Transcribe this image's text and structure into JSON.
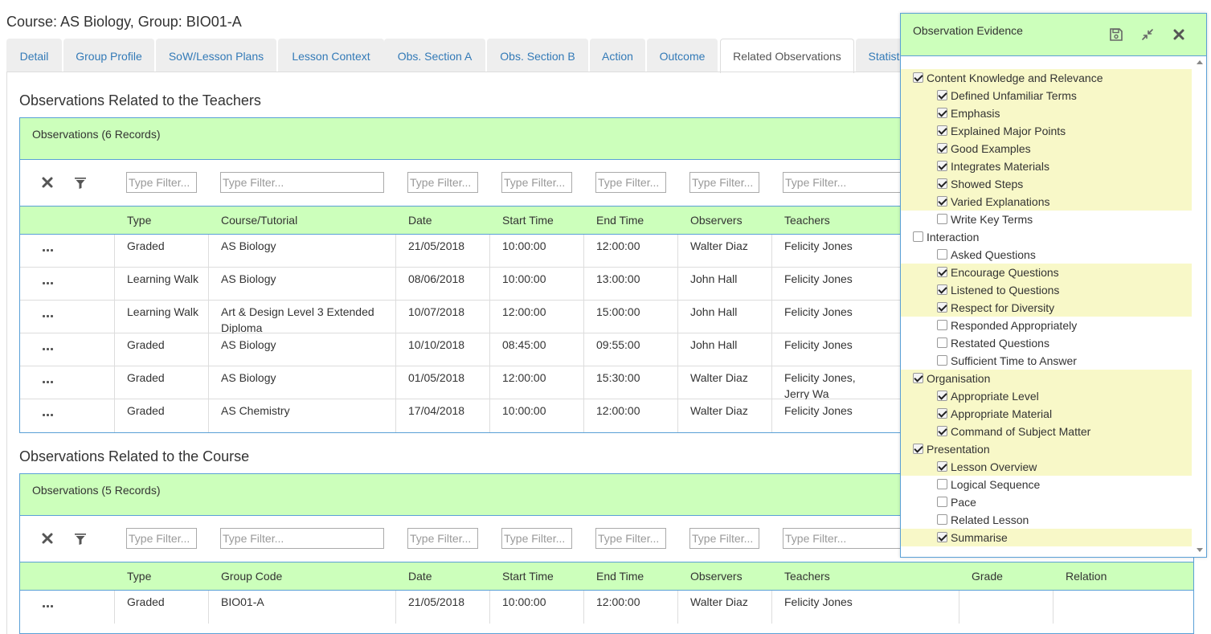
{
  "page_title": "Course: AS Biology, Group: BIO01-A",
  "tabs": [
    {
      "label": "Detail"
    },
    {
      "label": "Group Profile"
    },
    {
      "label": "SoW/Lesson Plans"
    },
    {
      "label": "Lesson Context"
    },
    {
      "label": "Obs. Section A"
    },
    {
      "label": "Obs. Section B"
    },
    {
      "label": "Action"
    },
    {
      "label": "Outcome"
    },
    {
      "label": "Related Observations"
    },
    {
      "label": "Statist"
    }
  ],
  "active_tab": "Related Observations",
  "filter_placeholder": "Type Filter...",
  "teachers_section": {
    "title": "Observations Related to the Teachers",
    "grid_title": "Observations (6 Records)",
    "columns": [
      "Type",
      "Course/Tutorial",
      "Date",
      "Start Time",
      "End Time",
      "Observers",
      "Teachers"
    ],
    "rows": [
      [
        "Graded",
        "AS Biology",
        "21/05/2018",
        "10:00:00",
        "12:00:00",
        "Walter Diaz",
        "Felicity Jones"
      ],
      [
        "Learning Walk",
        "AS Biology",
        "08/06/2018",
        "10:00:00",
        "13:00:00",
        "John Hall",
        "Felicity Jones"
      ],
      [
        "Learning Walk",
        "Art & Design Level 3 Extended Diploma",
        "10/07/2018",
        "12:00:00",
        "15:00:00",
        "John Hall",
        "Felicity Jones"
      ],
      [
        "Graded",
        "AS Biology",
        "10/10/2018",
        "08:45:00",
        "09:55:00",
        "John Hall",
        "Felicity Jones"
      ],
      [
        "Graded",
        "AS Biology",
        "01/05/2018",
        "12:00:00",
        "15:30:00",
        "Walter Diaz",
        "Felicity Jones, Jerry Wa"
      ],
      [
        "Graded",
        "AS Chemistry",
        "17/04/2018",
        "10:00:00",
        "12:00:00",
        "Walter Diaz",
        "Felicity Jones"
      ]
    ]
  },
  "course_section": {
    "title": "Observations Related to the Course",
    "grid_title": "Observations (5 Records)",
    "columns": [
      "Type",
      "Group Code",
      "Date",
      "Start Time",
      "End Time",
      "Observers",
      "Teachers",
      "Grade",
      "Relation"
    ],
    "rows": [
      [
        "Graded",
        "BIO01-A",
        "21/05/2018",
        "10:00:00",
        "12:00:00",
        "Walter Diaz",
        "Felicity Jones",
        "",
        ""
      ]
    ]
  },
  "panel": {
    "title": "Observation Evidence",
    "items": [
      {
        "label": "Content Knowledge and Relevance",
        "level": 0,
        "checked": true,
        "highlight": true
      },
      {
        "label": "Defined Unfamiliar Terms",
        "level": 1,
        "checked": true,
        "highlight": true
      },
      {
        "label": "Emphasis",
        "level": 1,
        "checked": true,
        "highlight": true
      },
      {
        "label": "Explained Major Points",
        "level": 1,
        "checked": true,
        "highlight": true
      },
      {
        "label": "Good Examples",
        "level": 1,
        "checked": true,
        "highlight": true
      },
      {
        "label": "Integrates Materials",
        "level": 1,
        "checked": true,
        "highlight": true
      },
      {
        "label": "Showed Steps",
        "level": 1,
        "checked": true,
        "highlight": true
      },
      {
        "label": "Varied Explanations",
        "level": 1,
        "checked": true,
        "highlight": true
      },
      {
        "label": "Write Key Terms",
        "level": 1,
        "checked": false,
        "highlight": false
      },
      {
        "label": "Interaction",
        "level": 0,
        "checked": false,
        "highlight": false
      },
      {
        "label": "Asked Questions",
        "level": 1,
        "checked": false,
        "highlight": false
      },
      {
        "label": "Encourage Questions",
        "level": 1,
        "checked": true,
        "highlight": true
      },
      {
        "label": "Listened to Questions",
        "level": 1,
        "checked": true,
        "highlight": true
      },
      {
        "label": "Respect for Diversity",
        "level": 1,
        "checked": true,
        "highlight": true
      },
      {
        "label": "Responded Appropriately",
        "level": 1,
        "checked": false,
        "highlight": false
      },
      {
        "label": "Restated Questions",
        "level": 1,
        "checked": false,
        "highlight": false
      },
      {
        "label": "Sufficient Time to Answer",
        "level": 1,
        "checked": false,
        "highlight": false
      },
      {
        "label": "Organisation",
        "level": 0,
        "checked": true,
        "highlight": true
      },
      {
        "label": "Appropriate Level",
        "level": 1,
        "checked": true,
        "highlight": true
      },
      {
        "label": "Appropriate Material",
        "level": 1,
        "checked": true,
        "highlight": true
      },
      {
        "label": "Command of Subject Matter",
        "level": 1,
        "checked": true,
        "highlight": true
      },
      {
        "label": "Presentation",
        "level": 0,
        "checked": true,
        "highlight": true
      },
      {
        "label": "Lesson Overview",
        "level": 1,
        "checked": true,
        "highlight": true
      },
      {
        "label": "Logical Sequence",
        "level": 1,
        "checked": false,
        "highlight": false
      },
      {
        "label": "Pace",
        "level": 1,
        "checked": false,
        "highlight": false
      },
      {
        "label": "Related Lesson",
        "level": 1,
        "checked": false,
        "highlight": false
      },
      {
        "label": "Summarise",
        "level": 1,
        "checked": true,
        "highlight": true
      }
    ]
  },
  "colors": {
    "header_green": "#ccffbb",
    "highlight_yellow": "#f8f8c8",
    "grid_border": "#5aa0d6",
    "link_blue": "#337ab7"
  }
}
